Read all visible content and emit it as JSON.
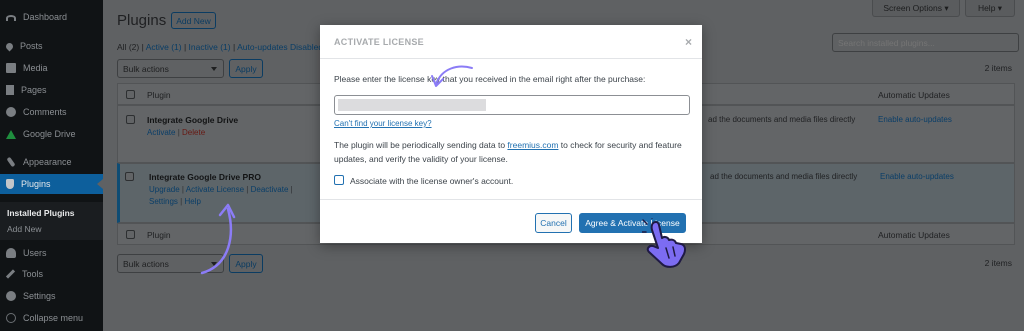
{
  "sidebar": {
    "items": [
      {
        "label": "Dashboard",
        "icon": "dashboard-icon"
      },
      {
        "label": "Posts",
        "icon": "pin-icon"
      },
      {
        "label": "Media",
        "icon": "media-icon"
      },
      {
        "label": "Pages",
        "icon": "pages-icon"
      },
      {
        "label": "Comments",
        "icon": "comments-icon"
      },
      {
        "label": "Google Drive",
        "icon": "google-drive-icon"
      },
      {
        "label": "Appearance",
        "icon": "brush-icon"
      },
      {
        "label": "Plugins",
        "icon": "plugin-icon"
      },
      {
        "label": "Users",
        "icon": "users-icon"
      },
      {
        "label": "Tools",
        "icon": "wrench-icon"
      },
      {
        "label": "Settings",
        "icon": "settings-icon"
      },
      {
        "label": "Collapse menu",
        "icon": "collapse-icon"
      }
    ],
    "submenu": {
      "installed": "Installed Plugins",
      "add_new": "Add New"
    }
  },
  "header": {
    "title": "Plugins",
    "add_new": "Add New",
    "screen_options": "Screen Options ▾",
    "help": "Help ▾"
  },
  "filters": {
    "all": "All",
    "all_count": "(2)",
    "active": "Active",
    "active_count": "(1)",
    "inactive": "Inactive",
    "inactive_count": "(1)",
    "autoupdates": "Auto-updates Disabled"
  },
  "search": {
    "placeholder": "Search installed plugins..."
  },
  "bulk": {
    "top": "Bulk actions",
    "bottom": "Bulk actions",
    "apply": "Apply"
  },
  "items_count": "2 items",
  "table": {
    "col_plugin": "Plugin",
    "col_auto": "Automatic Updates",
    "rows": [
      {
        "name": "Integrate Google Drive",
        "actions": [
          "Activate",
          "Delete"
        ],
        "desc": "ad the documents and media files directly",
        "auto": "Enable auto-updates"
      },
      {
        "name": "Integrate Google Drive PRO",
        "actions": [
          "Upgrade",
          "Activate License",
          "Deactivate",
          "Settings",
          "Help"
        ],
        "desc": "ad the documents and media files directly",
        "auto": "Enable auto-updates"
      }
    ]
  },
  "modal": {
    "title": "ACTIVATE LICENSE",
    "close": "×",
    "instruction": "Please enter the license key that you received in the email right after the purchase:",
    "cant_find": "Can't find your license key?",
    "para_before": "The plugin will be periodically sending data to ",
    "para_link": "freemius.com",
    "para_after": " to check for security and feature updates, and verify the validity of your license.",
    "associate": "Associate with the license owner's account.",
    "cancel": "Cancel",
    "agree": "Agree & Activate License"
  },
  "colors": {
    "accent": "#2271b1",
    "sidebar_bg": "#101315",
    "sidebar_active": "#0d5f9c",
    "overlay": "#5f6163",
    "arrow": "#8b7cf6"
  }
}
